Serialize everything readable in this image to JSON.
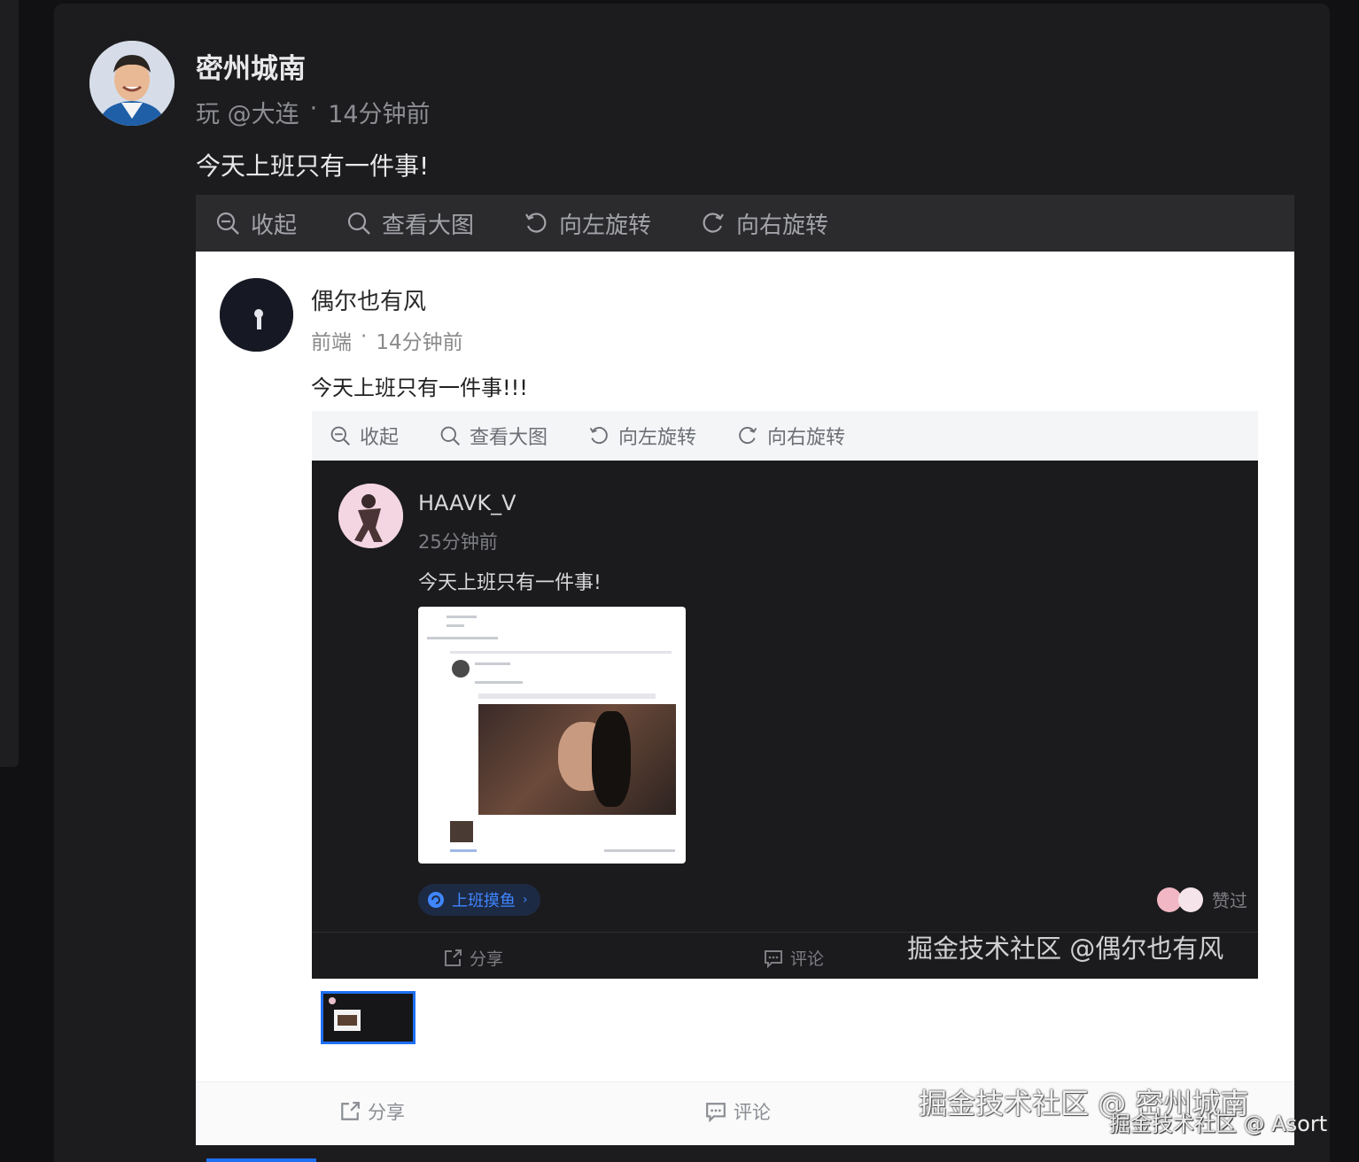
{
  "outer_post": {
    "author": "密州城南",
    "tag": "玩 @大连",
    "separator": "·",
    "time": "14分钟前",
    "content": "今天上班只有一件事!",
    "toolbar": {
      "collapse": "收起",
      "view_large": "查看大图",
      "rotate_left": "向左旋转",
      "rotate_right": "向右旋转"
    },
    "footer": {
      "share": "分享",
      "comment": "评论"
    },
    "watermark": "掘金技术社区 @ 密州城南"
  },
  "inner_post": {
    "author": "偶尔也有风",
    "tag": "前端",
    "separator": "·",
    "time": "14分钟前",
    "content": "今天上班只有一件事!!!",
    "toolbar": {
      "collapse": "收起",
      "view_large": "查看大图",
      "rotate_left": "向左旋转",
      "rotate_right": "向右旋转"
    }
  },
  "nested_post": {
    "author": "HAAVK_V",
    "time": "25分钟前",
    "content": "今天上班只有一件事!",
    "topic": "上班摸鱼",
    "liked_label": "赞过",
    "footer": {
      "share": "分享",
      "comment": "评论"
    },
    "watermark": "掘金技术社区 @偶尔也有风"
  },
  "page_watermark": "掘金技术社区 @ Asort",
  "colors": {
    "page_bg": "#111113",
    "card_bg": "#1c1c1e",
    "accent_blue": "#1f6ff2",
    "topic_blue": "#3f86ff"
  }
}
